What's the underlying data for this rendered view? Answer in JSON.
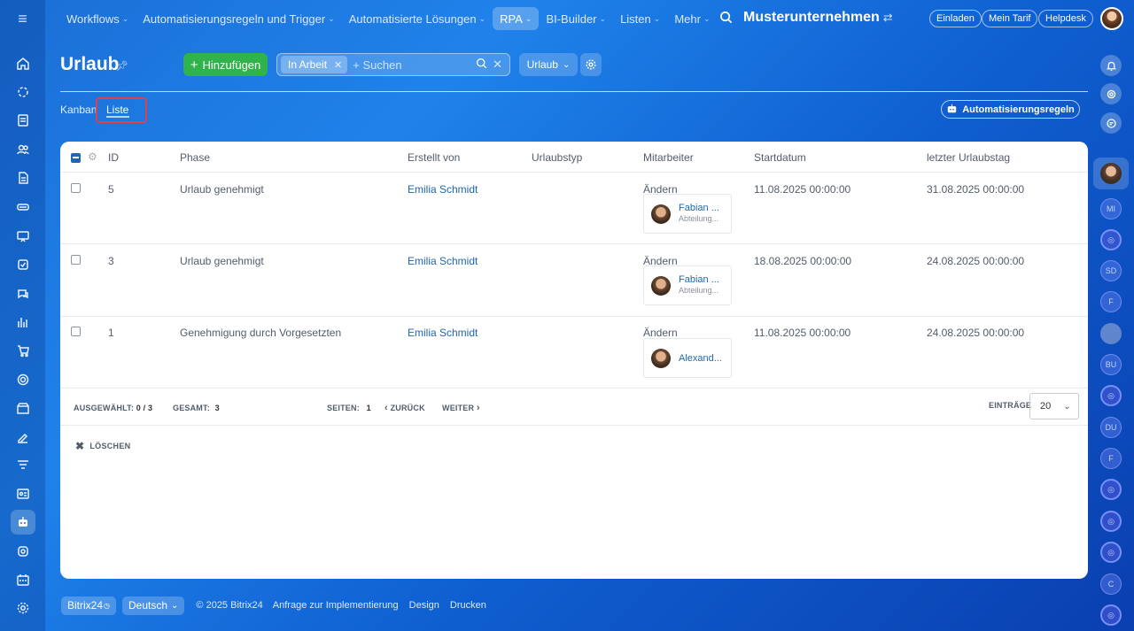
{
  "topnav": {
    "items": [
      {
        "label": "Workflows"
      },
      {
        "label": "Automatisierungsregeln und Trigger"
      },
      {
        "label": "Automatisierte Lösungen"
      },
      {
        "label": "RPA"
      },
      {
        "label": "BI-Builder"
      },
      {
        "label": "Listen"
      },
      {
        "label": "Mehr"
      }
    ],
    "company": "Musterunternehmen",
    "invite": "Einladen",
    "tariff": "Mein Tarif",
    "helpdesk": "Helpdesk"
  },
  "page": {
    "title": "Urlaub",
    "add_label": "Hinzufügen",
    "filter_chip": "In Arbeit",
    "search_placeholder": "+ Suchen",
    "entity_select": "Urlaub",
    "views": {
      "kanban": "Kanban",
      "list": "Liste"
    },
    "automation_label": "Automatisierungsregeln"
  },
  "table": {
    "columns": [
      "ID",
      "Phase",
      "Erstellt von",
      "Urlaubstyp",
      "Mitarbeiter",
      "Startdatum",
      "letzter Urlaubstag"
    ],
    "rows": [
      {
        "id": "5",
        "phase": "Urlaub genehmigt",
        "creator": "Emilia Schmidt",
        "type": "",
        "change": "Ändern",
        "employee": "Fabian ...",
        "dept": "Abteilung...",
        "start": "11.08.2025 00:00:00",
        "end": "31.08.2025 00:00:00"
      },
      {
        "id": "3",
        "phase": "Urlaub genehmigt",
        "creator": "Emilia Schmidt",
        "type": "",
        "change": "Ändern",
        "employee": "Fabian ...",
        "dept": "Abteilung...",
        "start": "18.08.2025 00:00:00",
        "end": "24.08.2025 00:00:00"
      },
      {
        "id": "1",
        "phase": "Genehmigung durch Vorgesetzten",
        "creator": "Emilia Schmidt",
        "type": "",
        "change": "Ändern",
        "employee": "Alexand...",
        "dept": "",
        "start": "11.08.2025 00:00:00",
        "end": "24.08.2025 00:00:00"
      }
    ]
  },
  "footer": {
    "selected_label": "AUSGEWÄHLT:",
    "selected_value": "0 / 3",
    "total_label": "GESAMT:",
    "total_value": "3",
    "pages_label": "SEITEN:",
    "pages_value": "1",
    "back": "ZURÜCK",
    "next": "WEITER",
    "entries_label": "EINTRÄGE",
    "entries_value": "20",
    "delete": "LÖSCHEN"
  },
  "bottom": {
    "brand": "Bitrix24",
    "language": "Deutsch",
    "copyright": "© 2025 Bitrix24",
    "impl": "Anfrage zur Implementierung",
    "design": "Design",
    "print": "Drucken"
  },
  "rightbar": {
    "initials": [
      "MI",
      "SD",
      "F",
      "BU",
      "DU",
      "F",
      "C"
    ]
  }
}
